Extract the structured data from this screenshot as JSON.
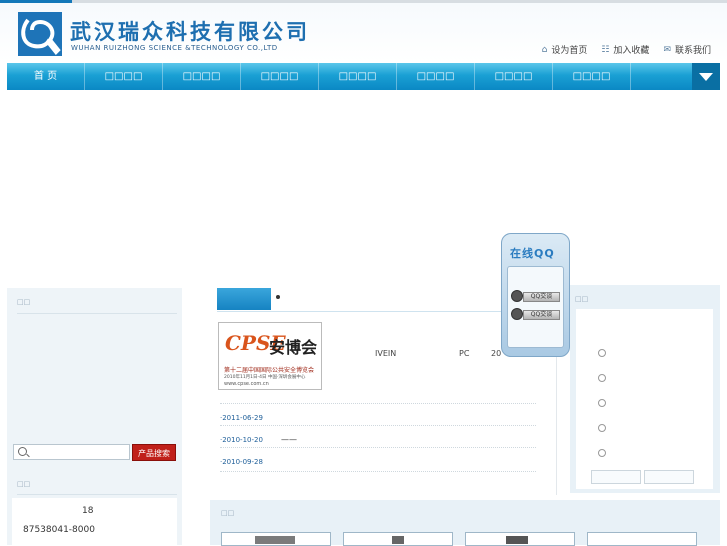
{
  "header": {
    "company_cn": "武汉瑞众科技有限公司",
    "company_en": "WUHAN RUIZHONG SCIENCE &TECHNOLOGY CO.,LTD",
    "links": [
      {
        "icon": "home-icon",
        "label": "设为首页"
      },
      {
        "icon": "favorites-icon",
        "label": "加入收藏"
      },
      {
        "icon": "mail-icon",
        "label": "联系我们"
      }
    ]
  },
  "nav": {
    "items": [
      "首 页",
      "□□□□",
      "□□□□",
      "□□□□",
      "□□□□",
      "□□□□",
      "□□□□",
      "□□□□"
    ]
  },
  "sidebar": {
    "title1": "□□",
    "search_button": "产品搜索",
    "title2": "□□",
    "contact_num": "18",
    "contact_phone": "87538041-8000"
  },
  "news": {
    "featured_image": {
      "logo_text": "CPSE",
      "cn": "安博会",
      "line": "第十二届中国国际公共安全博览会",
      "sub": "2010年11月1日-4日 中国·深圳会展中心",
      "url": "www.cpse.com.cn"
    },
    "featured_text_a": "IVEIN",
    "featured_text_b": "PC",
    "featured_text_c": "20",
    "items": [
      {
        "date": "·2011-06-29",
        "text": ""
      },
      {
        "date": "·2010-10-20",
        "text": "——"
      },
      {
        "date": "·2010-09-28",
        "text": ""
      }
    ]
  },
  "right": {
    "title": "□□"
  },
  "products": {
    "title": "□□"
  },
  "qq": {
    "title": "在线QQ",
    "buttons": [
      "QQ交谈",
      "QQ交谈"
    ]
  },
  "colors": {
    "nav": "#1aa0d4",
    "brand": "#1e6fb0",
    "search_button": "#c0201a"
  }
}
